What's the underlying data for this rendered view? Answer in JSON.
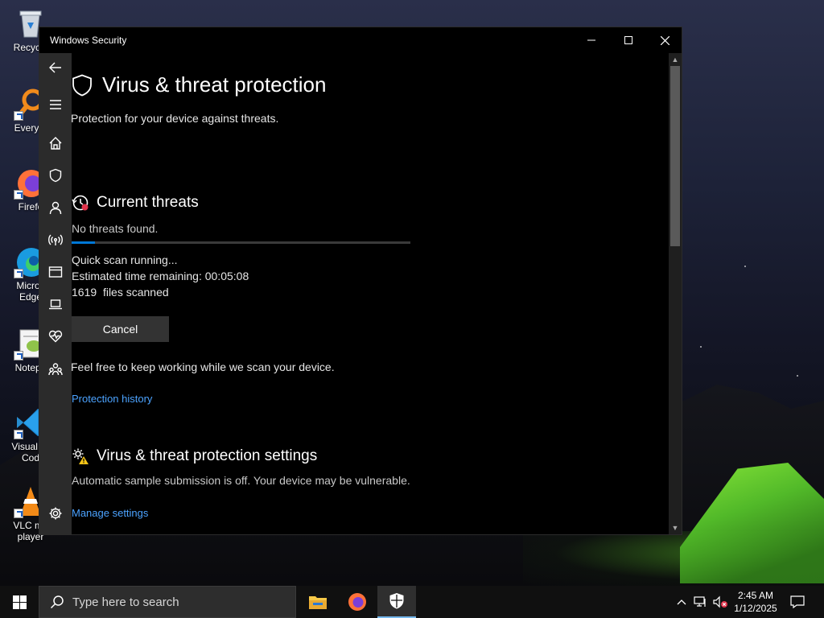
{
  "desktop": {
    "icons": [
      {
        "label": "Recycle",
        "icon": "recycle-bin-icon"
      },
      {
        "label": "Everyth",
        "icon": "everything-search-icon"
      },
      {
        "label": "Firefo",
        "icon": "firefox-icon"
      },
      {
        "label": "Micros\nEdge",
        "icon": "edge-icon"
      },
      {
        "label": "Notepa",
        "icon": "notepad-plus-plus-icon"
      },
      {
        "label": "Visual St\nCod",
        "icon": "vscode-icon"
      },
      {
        "label": "VLC me\nplayer",
        "icon": "vlc-icon"
      }
    ]
  },
  "window": {
    "title": "Windows Security",
    "controls": {
      "minimize": "minimize-icon",
      "maximize": "maximize-icon",
      "close": "close-icon"
    },
    "sidebar": [
      "back-arrow-icon",
      "hamburger-menu-icon",
      "home-icon",
      "shield-icon",
      "account-icon",
      "network-icon",
      "app-browser-icon",
      "device-icon",
      "health-heart-icon",
      "family-icon",
      "settings-gear-icon"
    ],
    "page": {
      "title": "Virus & threat protection",
      "subtitle": "Protection for your device against threats."
    },
    "current_threats": {
      "heading": "Current threats",
      "status": "No threats found.",
      "progress_percent": 7,
      "scan_status": "Quick scan running...",
      "time_label": "Estimated time remaining:",
      "time_value": "00:05:08",
      "files_count": "1619",
      "files_label": "files scanned",
      "cancel_label": "Cancel",
      "note": "Feel free to keep working while we scan your device.",
      "history_link": "Protection history"
    },
    "settings": {
      "heading": "Virus & threat protection settings",
      "status": "Automatic sample submission is off. Your device may be vulnerable.",
      "manage_link": "Manage settings"
    }
  },
  "taskbar": {
    "search_placeholder": "Type here to search",
    "apps": [
      "file-explorer-icon",
      "firefox-icon",
      "windows-security-icon"
    ],
    "clock": {
      "time": "2:45 AM",
      "date": "1/12/2025"
    }
  }
}
